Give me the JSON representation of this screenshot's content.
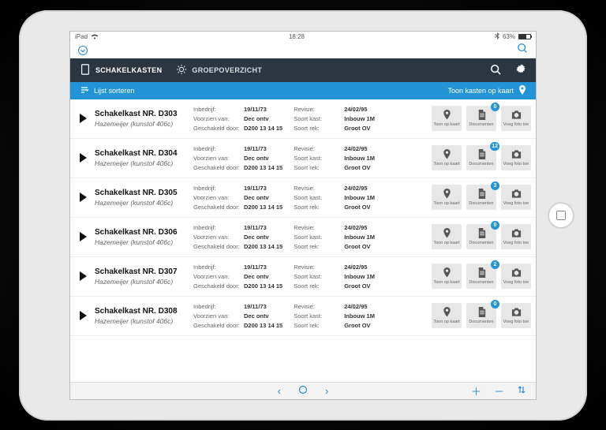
{
  "status": {
    "device": "iPad",
    "time": "18:28",
    "battery_pct": "63%"
  },
  "tabs": {
    "schakelkasten": "SCHAKELKASTEN",
    "groepoverzicht": "GROEPOVERZICHT"
  },
  "sortbar": {
    "sort": "Lijst sorteren",
    "map": "Toon kasten op kaart"
  },
  "labels": {
    "inbedrijf": "Inbedrijf:",
    "voorzien": "Voorzien van:",
    "geschakeld": "Geschakeld door:",
    "revisie": "Revisie:",
    "soortkast": "Soort kast:",
    "soortrek": "Soort rek:"
  },
  "action_labels": {
    "map": "Toon op kaart",
    "docs": "Documenten",
    "photo": "Voeg foto toe"
  },
  "rows": [
    {
      "title": "Schakelkast NR. D303",
      "subtitle": "Hazemeijer (kunstof 406c)",
      "inbedrijf": "19/11/73",
      "voorzien": "Dec ontv",
      "geschakeld": "D200 13 14 15",
      "revisie": "24/02/95",
      "soortkast": "Inbouw 1M",
      "soortrek": "Groot OV",
      "docs_badge": "0"
    },
    {
      "title": "Schakelkast NR. D304",
      "subtitle": "Hazemeijer (kunstof 406c)",
      "inbedrijf": "19/11/73",
      "voorzien": "Dec ontv",
      "geschakeld": "D200 13 14 15",
      "revisie": "24/02/95",
      "soortkast": "Inbouw 1M",
      "soortrek": "Groot OV",
      "docs_badge": "12"
    },
    {
      "title": "Schakelkast NR. D305",
      "subtitle": "Hazemeijer (kunstof 406c)",
      "inbedrijf": "19/11/73",
      "voorzien": "Dec ontv",
      "geschakeld": "D200 13 14 15",
      "revisie": "24/02/95",
      "soortkast": "Inbouw 1M",
      "soortrek": "Groot OV",
      "docs_badge": "3"
    },
    {
      "title": "Schakelkast NR. D306",
      "subtitle": "Hazemeijer (kunstof 406c)",
      "inbedrijf": "19/11/73",
      "voorzien": "Dec ontv",
      "geschakeld": "D200 13 14 15",
      "revisie": "24/02/95",
      "soortkast": "Inbouw 1M",
      "soortrek": "Groot OV",
      "docs_badge": "0"
    },
    {
      "title": "Schakelkast NR. D307",
      "subtitle": "Hazemeijer (kunstof 406c)",
      "inbedrijf": "19/11/73",
      "voorzien": "Dec ontv",
      "geschakeld": "D200 13 14 15",
      "revisie": "24/02/95",
      "soortkast": "Inbouw 1M",
      "soortrek": "Groot OV",
      "docs_badge": "2"
    },
    {
      "title": "Schakelkast NR. D308",
      "subtitle": "Hazemeijer (kunstof 406c)",
      "inbedrijf": "19/11/73",
      "voorzien": "Dec ontv",
      "geschakeld": "D200 13 14 15",
      "revisie": "24/02/95",
      "soortkast": "Inbouw 1M",
      "soortrek": "Groot OV",
      "docs_badge": "0"
    }
  ]
}
